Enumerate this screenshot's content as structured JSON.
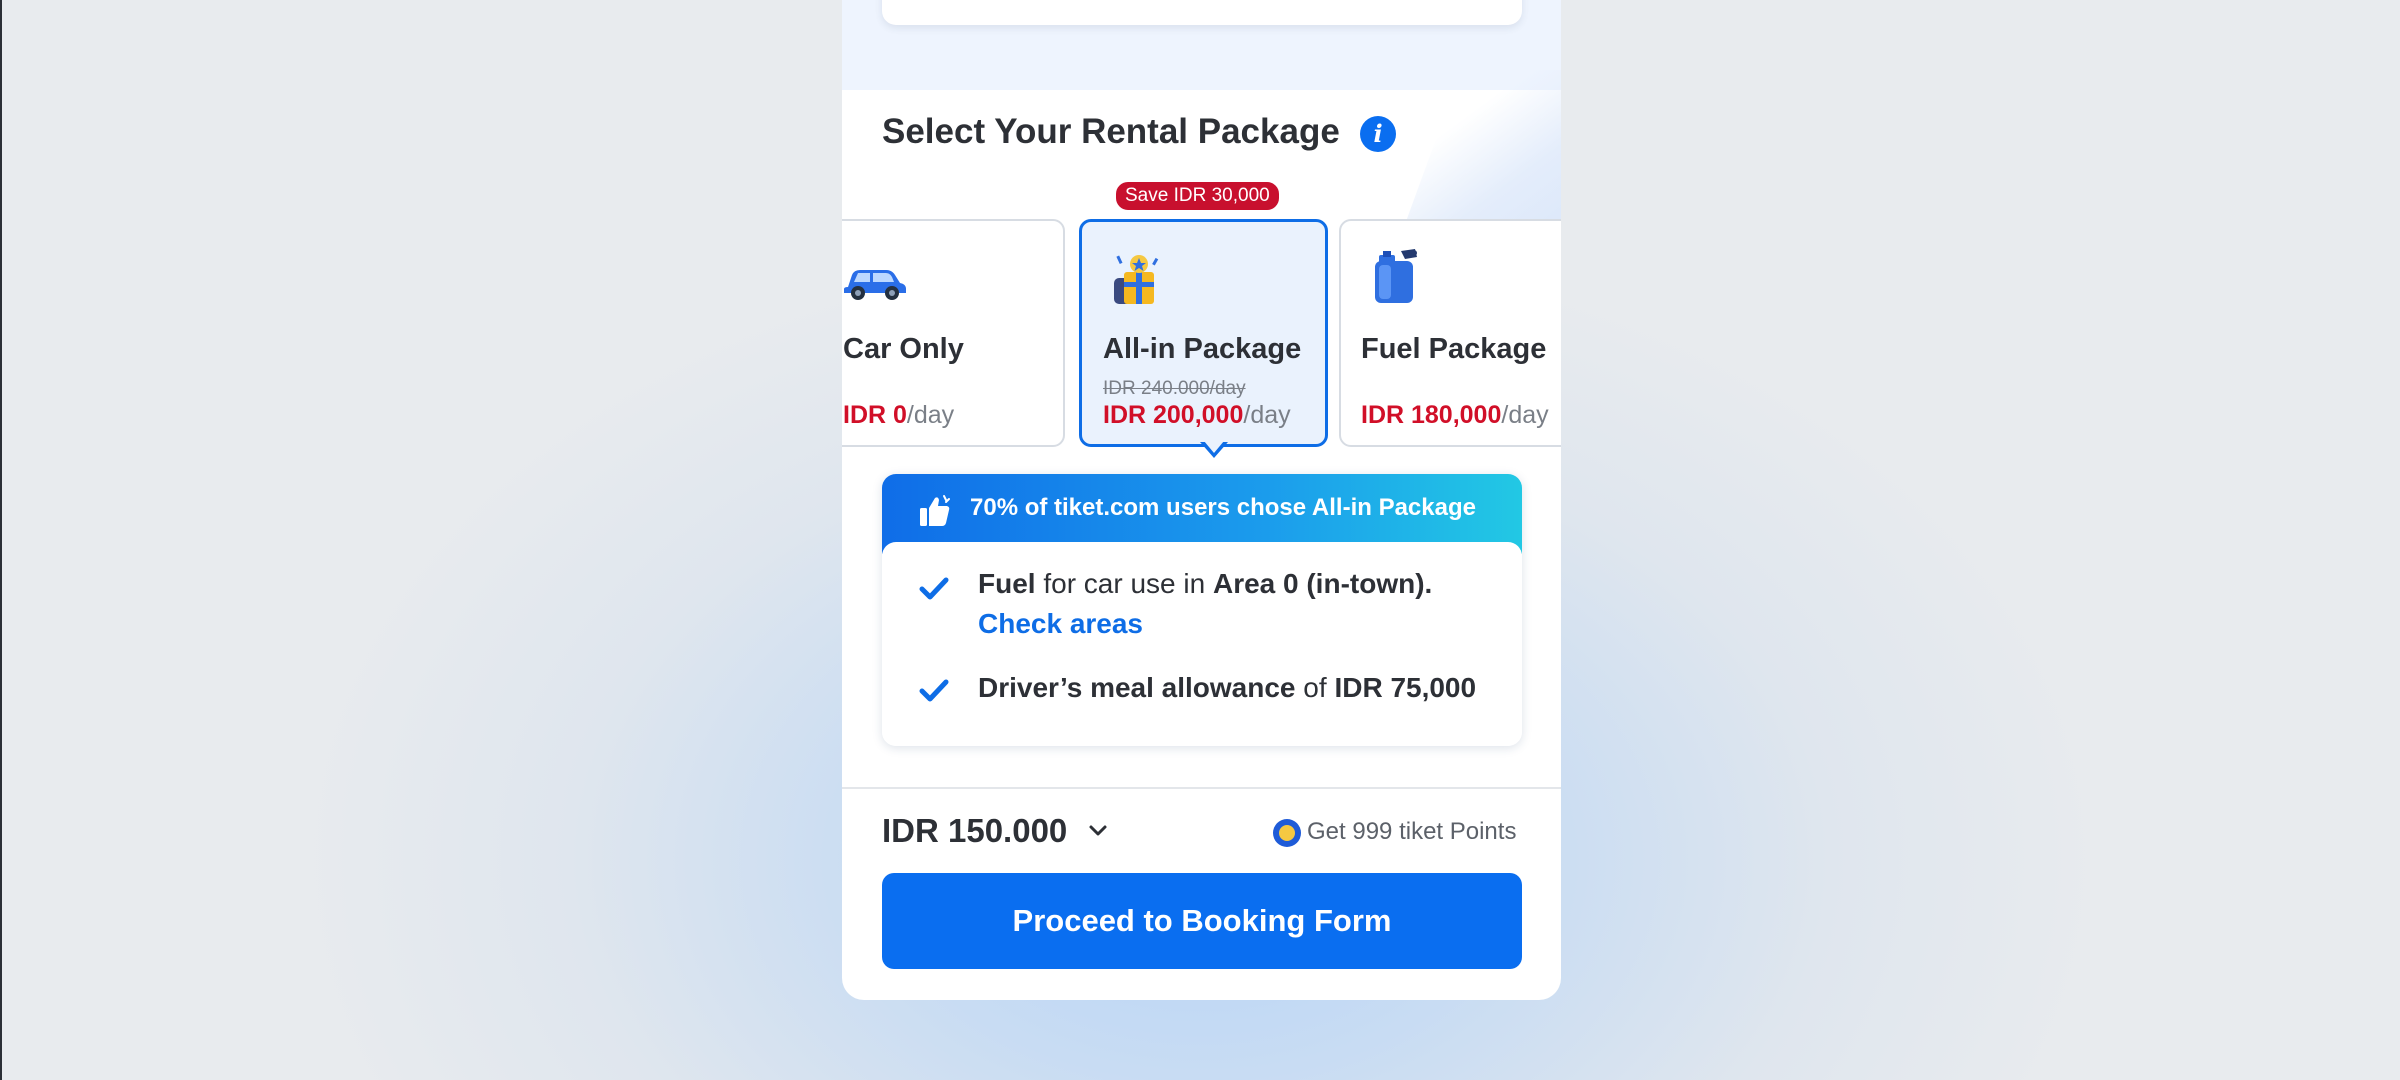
{
  "section": {
    "title": "Select Your Rental Package"
  },
  "packages": [
    {
      "name": "Car Only",
      "price": "IDR 0",
      "unit": "/day",
      "icon": "car-icon"
    },
    {
      "name": "All-in Package",
      "original_price": "IDR 240.000/day",
      "price": "IDR 200,000",
      "unit": "/day",
      "badge": "Save IDR 30,000",
      "icon": "gift-bag-icon",
      "selected": true
    },
    {
      "name": "Fuel Package",
      "price": "IDR 180,000",
      "unit": "/day",
      "icon": "fuel-can-icon"
    }
  ],
  "promo": {
    "headline": "70% of tiket.com users chose All-in Package",
    "features": [
      {
        "bold1": "Fuel",
        "text1": " for car use in ",
        "bold2": "Area 0 (in-town).",
        "link": "Check areas"
      },
      {
        "bold1": "Driver’s meal allowance",
        "text1": " of ",
        "bold2": "IDR 75,000"
      }
    ]
  },
  "footer": {
    "total": "IDR 150.000",
    "points": "Get 999 tiket Points",
    "cta": "Proceed to Booking Form"
  },
  "colors": {
    "primary": "#0a6ef0",
    "price_red": "#d10f28",
    "badge_red": "#c8102e"
  }
}
